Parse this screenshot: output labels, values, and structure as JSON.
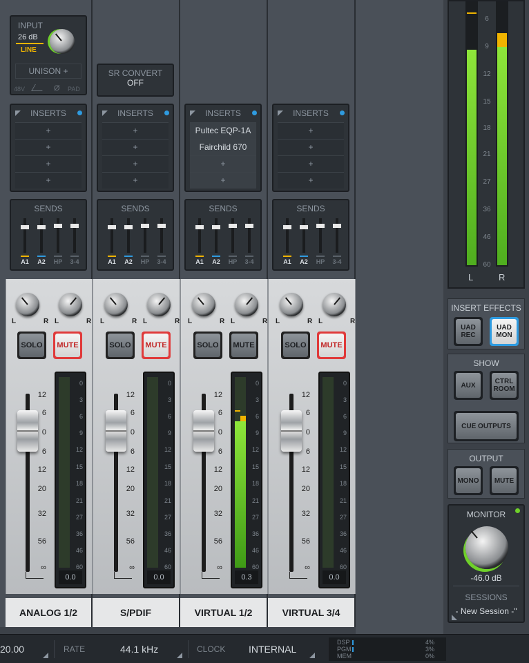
{
  "channels": [
    {
      "name": "ANALOG 1/2",
      "meter": "0.0",
      "inserts": [
        "+",
        "+",
        "+",
        "+"
      ]
    },
    {
      "name": "S/PDIF",
      "meter": "0.0",
      "inserts": [
        "+",
        "+",
        "+",
        "+"
      ]
    },
    {
      "name": "VIRTUAL 1/2",
      "meter": "0.3",
      "inserts": [
        "Pultec EQP-1A",
        "Fairchild 670",
        "+",
        "+"
      ]
    },
    {
      "name": "VIRTUAL 3/4",
      "meter": "0.0",
      "inserts": [
        "+",
        "+",
        "+",
        "+"
      ]
    }
  ],
  "preamp": {
    "title": "INPUT",
    "gain": "26 dB",
    "type": "LINE",
    "unison": "UNISON +",
    "v48": "48V",
    "phase": "Ø",
    "pad": "PAD"
  },
  "sr_convert": {
    "title": "SR CONVERT",
    "value": "OFF"
  },
  "labels": {
    "inserts": "INSERTS",
    "sends": "SENDS",
    "solo": "SOLO",
    "mute": "MUTE",
    "l": "L",
    "r": "R"
  },
  "send_labels": [
    "A1",
    "A2",
    "HP",
    "3-4"
  ],
  "fader_scale": [
    "12",
    "6",
    "0",
    "6",
    "12",
    "20",
    "32",
    "56",
    "∞"
  ],
  "meter_scale": [
    "0",
    "3",
    "6",
    "9",
    "12",
    "15",
    "18",
    "21",
    "27",
    "36",
    "46",
    "60"
  ],
  "master": {
    "scale": [
      "6",
      "9",
      "12",
      "15",
      "18",
      "21",
      "27",
      "36",
      "46",
      "60"
    ],
    "left": "L",
    "right": "R"
  },
  "insert_effects": {
    "title": "INSERT EFFECTS",
    "rec": "UAD REC",
    "mon": "UAD MON"
  },
  "show": {
    "title": "SHOW",
    "aux": "AUX",
    "ctrl": "CTRL ROOM",
    "cue": "CUE OUTPUTS"
  },
  "output": {
    "title": "OUTPUT",
    "mono": "MONO",
    "mute": "MUTE"
  },
  "monitor": {
    "title": "MONITOR",
    "level": "-46.0 dB",
    "sessions_title": "SESSIONS",
    "session": "- New Session -\""
  },
  "footer": {
    "buffer": "20.00",
    "rate_label": "RATE",
    "rate": "44.1 kHz",
    "clock_label": "CLOCK",
    "clock": "INTERNAL",
    "dsp_label": "DSP",
    "pgm_label": "PGM",
    "mem_label": "MEM",
    "dsp": "4%",
    "pgm": "3%",
    "mem": "0%"
  },
  "colors": {
    "meter_green": "#6fd12a",
    "meter_yellow": "#f0b400",
    "mute_red": "#e03a3a",
    "mon_blue": "#2f9be0"
  }
}
